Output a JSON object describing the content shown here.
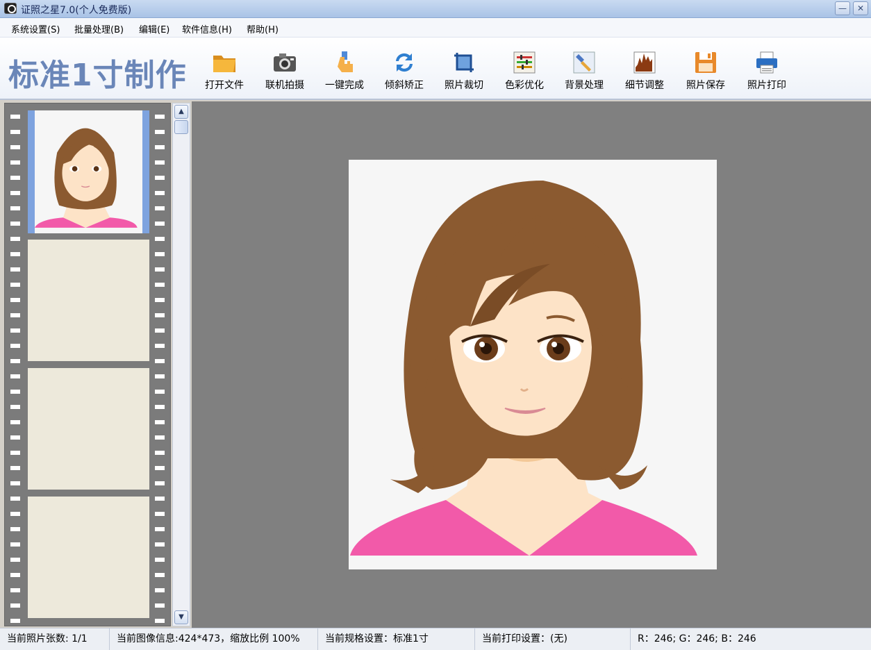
{
  "window": {
    "title": "证照之星7.0(个人免费版)",
    "min_glyph": "—",
    "close_glyph": "✕"
  },
  "menu": [
    "系统设置(S)",
    "批量处理(B)",
    "编辑(E)",
    "软件信息(H)",
    "帮助(H)"
  ],
  "toolbar": {
    "brand": "标准1寸制作",
    "tools": [
      {
        "label": "打开文件",
        "icon": "folder-icon"
      },
      {
        "label": "联机拍摄",
        "icon": "camera-icon"
      },
      {
        "label": "一键完成",
        "icon": "hand-pointer-icon"
      },
      {
        "label": "倾斜矫正",
        "icon": "rotate-icon"
      },
      {
        "label": "照片裁切",
        "icon": "crop-icon"
      },
      {
        "label": "色彩优化",
        "icon": "color-sliders-icon"
      },
      {
        "label": "背景处理",
        "icon": "brush-icon"
      },
      {
        "label": "细节调整",
        "icon": "histogram-icon"
      },
      {
        "label": "照片保存",
        "icon": "floppy-icon"
      },
      {
        "label": "照片打印",
        "icon": "printer-icon"
      }
    ]
  },
  "scrollbar": {
    "up_glyph": "▲",
    "down_glyph": "▼"
  },
  "status": {
    "count": "当前照片张数: 1/1",
    "image_info": "当前图像信息:424*473，缩放比例 100%",
    "spec": "当前规格设置：标准1寸",
    "print": "当前打印设置：(无)",
    "rgb": "R：246; G：246; B：246"
  },
  "colors": {
    "brand": "#6a86b8",
    "canvas": "#808080",
    "hair": "#8b5a30",
    "shirt": "#f25aa9",
    "skin": "#fde3c7"
  }
}
